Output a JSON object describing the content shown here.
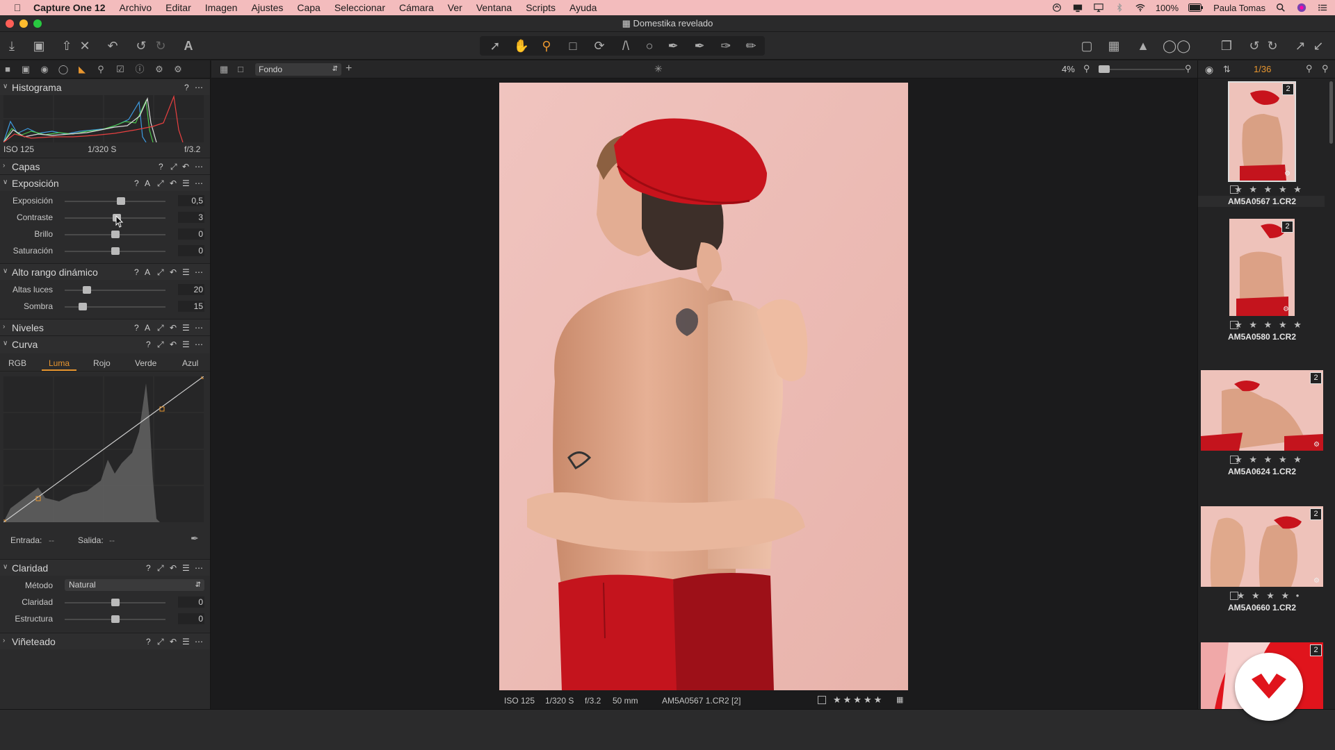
{
  "menubar": {
    "items": [
      "Capture One 12",
      "Archivo",
      "Editar",
      "Imagen",
      "Ajustes",
      "Capa",
      "Seleccionar",
      "Cámara",
      "Ver",
      "Ventana",
      "Scripts",
      "Ayuda"
    ],
    "battery": "100%",
    "user": "Paula Tomas"
  },
  "window": {
    "title": "Domestika revelado"
  },
  "viewer_bar": {
    "preset": "Fondo",
    "zoom": "4%"
  },
  "browser_bar": {
    "count": "1/36"
  },
  "histogram": {
    "title": "Histograma",
    "iso": "ISO 125",
    "shutter": "1/320 S",
    "aperture": "f/3.2"
  },
  "sections": {
    "capas": "Capas",
    "exposicion": "Exposición",
    "alto_rango": "Alto rango dinámico",
    "niveles": "Niveles",
    "curva": "Curva",
    "claridad": "Claridad",
    "vineteado": "Viñeteado"
  },
  "exposure_sliders": [
    {
      "label": "Exposición",
      "value": "0,5",
      "level": 0.56
    },
    {
      "label": "Contraste",
      "value": "3",
      "level": 0.52
    },
    {
      "label": "Brillo",
      "value": "0",
      "level": 0.5
    },
    {
      "label": "Saturación",
      "value": "0",
      "level": 0.5
    }
  ],
  "hdr_sliders": [
    {
      "label": "Altas luces",
      "value": "20",
      "level": 0.22
    },
    {
      "label": "Sombra",
      "value": "15",
      "level": 0.18
    }
  ],
  "curve": {
    "tabs": [
      "RGB",
      "Luma",
      "Rojo",
      "Verde",
      "Azul"
    ],
    "active_tab": "Luma",
    "input_label": "Entrada:",
    "input_value": "--",
    "output_label": "Salida:",
    "output_value": "--"
  },
  "clarity": {
    "method_label": "Método",
    "method_value": "Natural",
    "sliders": [
      {
        "label": "Claridad",
        "value": "0",
        "level": 0.5
      },
      {
        "label": "Estructura",
        "value": "0",
        "level": 0.5
      }
    ]
  },
  "footer": {
    "iso": "ISO 125",
    "shutter": "1/320 S",
    "aperture": "f/3.2",
    "focal": "50 mm",
    "filename": "AM5A0567 1.CR2 [2]"
  },
  "thumbnails": [
    {
      "name": "AM5A0567 1.CR2",
      "badge": "2",
      "stars": "★ ★ ★ ★ ★"
    },
    {
      "name": "AM5A0580 1.CR2",
      "badge": "2",
      "stars": "★ ★ ★ ★ ★"
    },
    {
      "name": "AM5A0624 1.CR2",
      "badge": "2",
      "stars": "★ ★ ★ ★ ★"
    },
    {
      "name": "AM5A0660 1.CR2",
      "badge": "2",
      "stars": "★ ★ ★ ★ •"
    },
    {
      "badge": "2"
    }
  ],
  "colors": {
    "menubar_bg": "#f3bcbd",
    "accent_orange": "#e8962f",
    "beret_red": "#c8131c"
  }
}
